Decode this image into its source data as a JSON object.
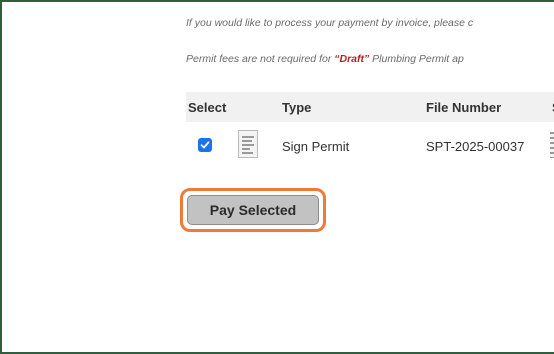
{
  "notes": {
    "invoice_line": "If you would like to process your payment by invoice, please c",
    "fees_prefix": "Permit fees are not required for ",
    "fees_draft": "“Draft”",
    "fees_suffix": " Plumbing Permit ap"
  },
  "table": {
    "headers": {
      "select": "Select",
      "type": "Type",
      "file_number": "File Number"
    },
    "rows": [
      {
        "selected": true,
        "icon": "document-icon",
        "type": "Sign Permit",
        "file_number": "SPT-2025-00037"
      }
    ]
  },
  "actions": {
    "pay_selected_label": "Pay Selected",
    "highlight_color": "#f07a3a"
  },
  "colors": {
    "frame": "#2f5e3e",
    "checkbox": "#1a73e8",
    "draft_text": "#b22222"
  }
}
